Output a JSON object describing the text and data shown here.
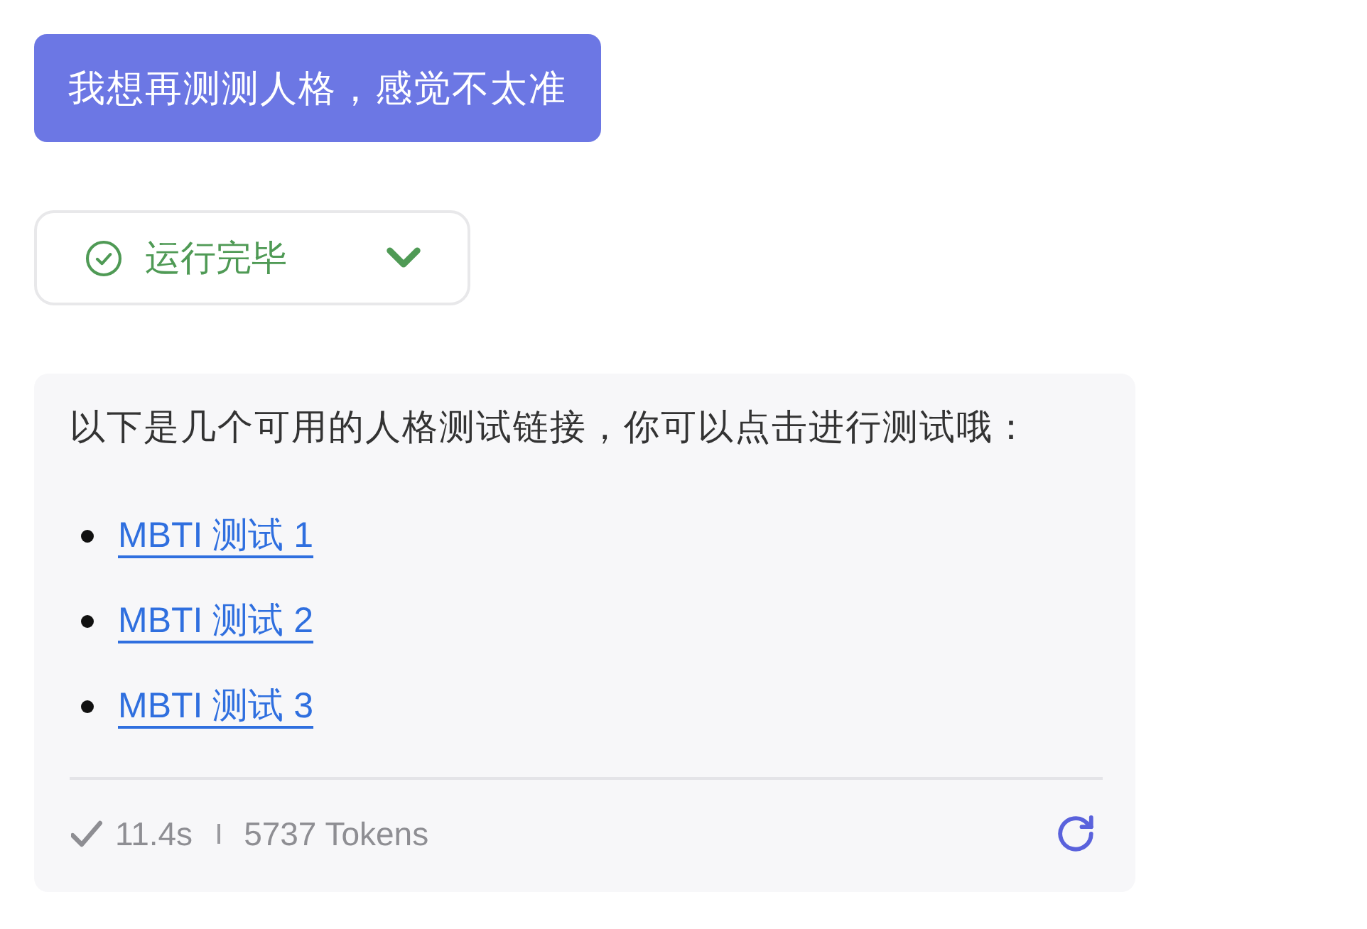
{
  "user_message": {
    "text": "我想再测测人格，感觉不太准"
  },
  "run_status": {
    "completed": true,
    "label": "运行完毕",
    "expanded": false
  },
  "response": {
    "intro": "以下是几个可用的人格测试链接，你可以点击进行测试哦：",
    "links": [
      {
        "text": "MBTI 测试 1"
      },
      {
        "text": "MBTI 测试 2"
      },
      {
        "text": "MBTI 测试 3"
      }
    ],
    "footer": {
      "duration": "11.4s",
      "tokens": "5737 Tokens"
    }
  }
}
